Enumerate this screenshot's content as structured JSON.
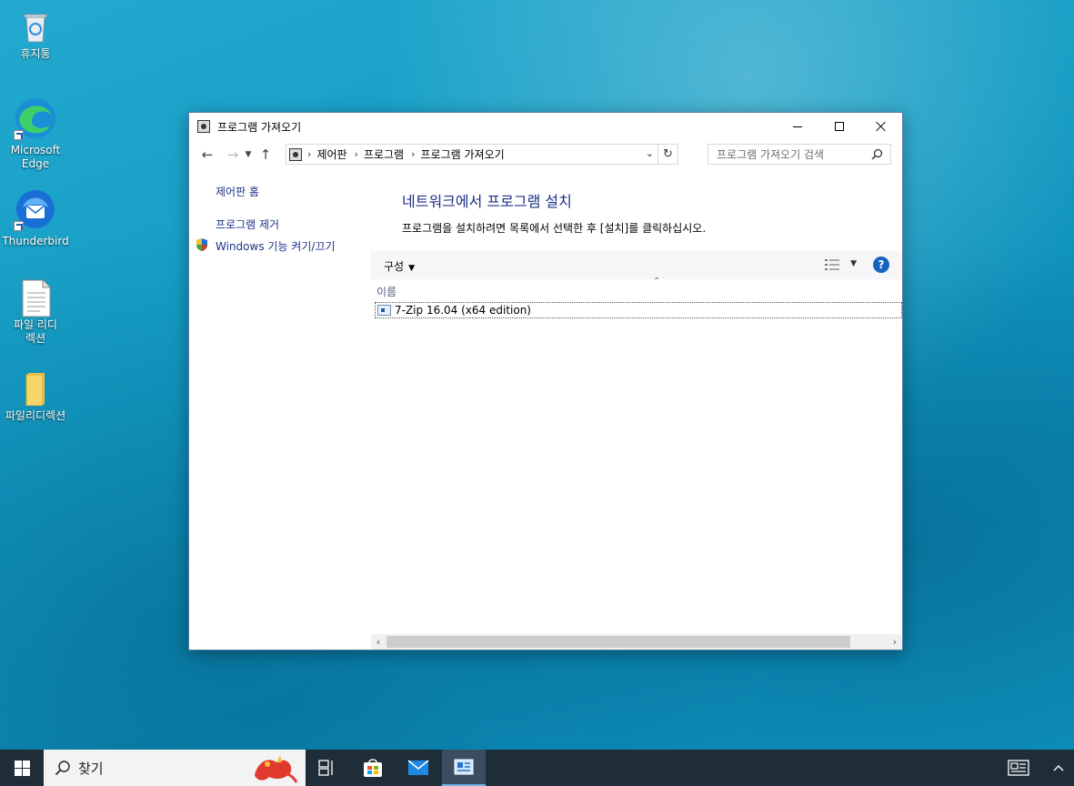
{
  "desktop": {
    "icons": [
      {
        "label": "휴지통"
      },
      {
        "label": "Microsoft Edge"
      },
      {
        "label": "Thunderbird"
      },
      {
        "label": "파일 리디렉션"
      },
      {
        "label": "파일리디렉션"
      }
    ]
  },
  "window": {
    "title": "프로그램 가져오기",
    "breadcrumb": [
      "제어판",
      "프로그램",
      "프로그램 가져오기"
    ],
    "search_placeholder": "프로그램 가져오기 검색"
  },
  "sidebar": {
    "items": [
      {
        "label": "제어판 홈"
      },
      {
        "label": "프로그램 제거"
      },
      {
        "label": "Windows 기능 켜기/끄기"
      }
    ]
  },
  "main": {
    "heading": "네트워크에서 프로그램 설치",
    "description": "프로그램을 설치하려면 목록에서 선택한 후 [설치]를 클릭하십시오.",
    "toolbar": {
      "organize_label": "구성",
      "help_label": "?"
    },
    "columns": [
      "이름"
    ],
    "rows": [
      {
        "name": "7-Zip 16.04 (x64 edition)"
      }
    ]
  },
  "taskbar": {
    "search_label": "찾기"
  },
  "colors": {
    "link": "#1e3287",
    "heading": "#1e3287",
    "taskbar": "#1f2d38",
    "accent": "#1565c0"
  }
}
